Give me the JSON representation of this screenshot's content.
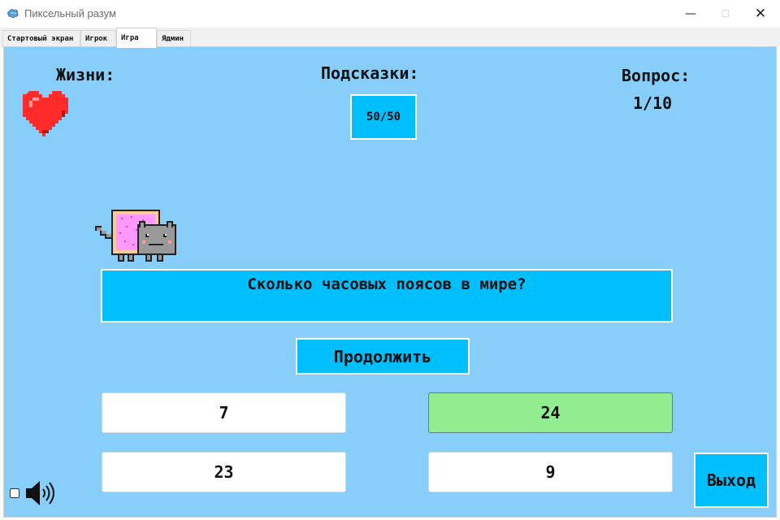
{
  "window": {
    "title": "Пиксельный разум",
    "icon": "brain-icon",
    "controls": {
      "minimize": "—",
      "maximize": "☐",
      "close": "✕"
    }
  },
  "tabs": [
    {
      "label": "Стартовый экран",
      "active": false
    },
    {
      "label": "Игрок",
      "active": false
    },
    {
      "label": "Игра",
      "active": true
    },
    {
      "label": "Ядмин",
      "active": false
    }
  ],
  "game": {
    "lives_label": "Жизни:",
    "lives_icon": "heart-icon",
    "lives_count": 1,
    "hints_label": "Подсказки:",
    "hint_button": "50/50",
    "question_label": "Вопрос:",
    "question_counter": "1/10",
    "mascot_icon": "nyan-cat-icon",
    "question_text": "Сколько часовых поясов в мире?",
    "continue_button": "Продолжить",
    "answers": [
      {
        "label": "7",
        "correct": false
      },
      {
        "label": "24",
        "correct": true
      },
      {
        "label": "23",
        "correct": false
      },
      {
        "label": "9",
        "correct": false
      }
    ],
    "exit_button": "Выход",
    "sound_checkbox_checked": false,
    "sound_icon": "speaker-icon"
  },
  "colors": {
    "background": "#87cefa",
    "button": "#00bfff",
    "correct_answer": "#90ee90",
    "heart": "#ff2a2a"
  }
}
